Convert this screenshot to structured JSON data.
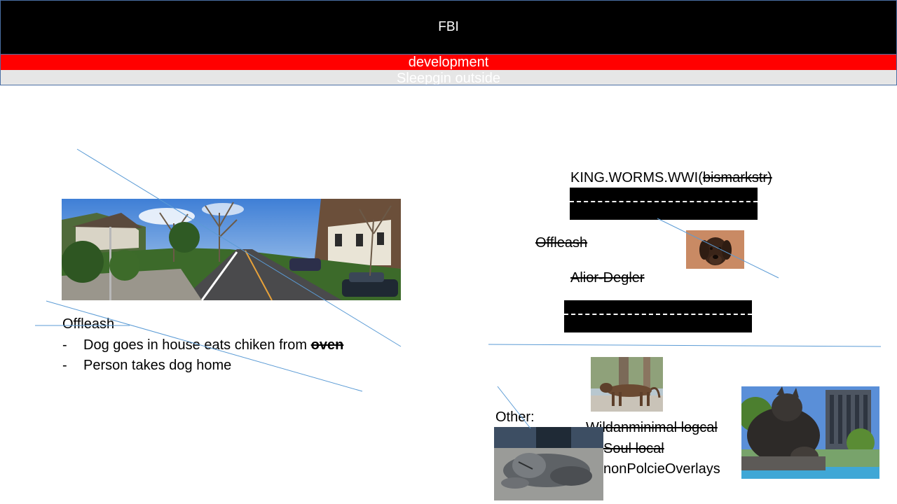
{
  "header": {
    "title": "FBI",
    "development": "development",
    "subtitle": "Sleepgin outside"
  },
  "left_section": {
    "heading": "Offleash",
    "bullets": [
      {
        "marker": "-",
        "text": "Dog goes in house eats chiken from ",
        "emphasis": "oven"
      },
      {
        "marker": "-",
        "text": "Person takes dog home"
      }
    ]
  },
  "right_section": {
    "king_label": "KING.WORMS.WWI(",
    "king_struck": "bismarkstr)",
    "offleash_struck": "Offleash",
    "alior_struck": "Alior-Degler"
  },
  "other_section": {
    "label": "Other:",
    "wild_struck": "Wildanminimal logcal",
    "soul_struck": "Soul local ",
    "overlays": "nonPolcieOverlays"
  },
  "images": {
    "street": "street-photo",
    "dog": "dog-portrait",
    "statue_walking": "walking-cat-statue",
    "statue_lying": "lying-lion-statue",
    "statue_puma": "puma-statue"
  },
  "colors": {
    "title_bg": "#000000",
    "dev_bg": "#ff0000",
    "sub_bg": "#e6e6e6",
    "connector": "#5b9bd5"
  }
}
